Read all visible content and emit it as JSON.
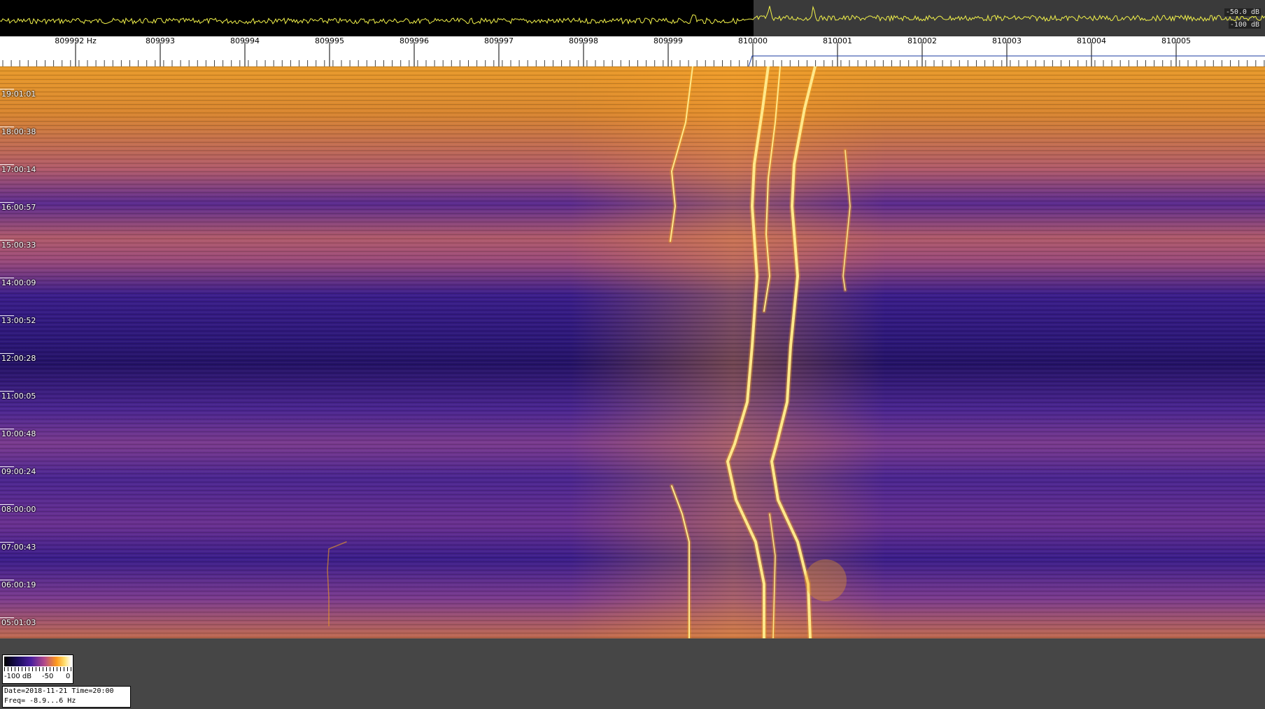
{
  "spectrum": {
    "db_top": "-50.0 dB",
    "db_bottom": "-100 dB",
    "trace_color": "#f2f24a"
  },
  "scale": {
    "freq_labels": [
      "809992 Hz",
      "809993",
      "809994",
      "809995",
      "809996",
      "809997",
      "809998",
      "809999",
      "810000",
      "810001",
      "810002",
      "810003",
      "810004",
      "810005"
    ]
  },
  "waterfall": {
    "time_labels": [
      "19:01:01",
      "18:00:38",
      "17:00:14",
      "16:00:57",
      "15:00:33",
      "14:00:09",
      "13:00:52",
      "12:00:28",
      "11:00:05",
      "10:00:48",
      "09:00:24",
      "08:00:00",
      "07:00:43",
      "06:00:19",
      "05:01:03"
    ],
    "colors": {
      "low": "#2a1670",
      "mid": "#7a2e8e",
      "high": "#f0a020",
      "peak": "#ffe88a"
    }
  },
  "legend": {
    "left_label": "-100 dB",
    "mid_label": "-50",
    "right_label": "0"
  },
  "info": {
    "line1": "Date=2018-11-21 Time=20:00",
    "line2": "Freq= -8.9...6 Hz"
  }
}
